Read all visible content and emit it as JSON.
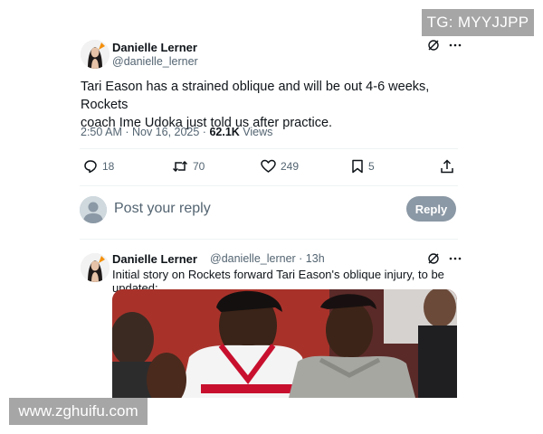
{
  "watermarks": {
    "tg": "TG: MYYJJPP",
    "site": "www.zghuifu.com"
  },
  "tweet": {
    "author_name": "Danielle Lerner",
    "author_handle": "@danielle_lerner",
    "text_line1": "Tari Eason has a strained oblique and will be out 4-6 weeks, Rockets",
    "text_line2": "coach Ime Udoka just told us after practice.",
    "timestamp": "2:50 AM · Nov 16, 2025 · ",
    "views_count": "62.1K",
    "views_label": " Views",
    "actions": {
      "replies": "18",
      "reposts": "70",
      "likes": "249",
      "bookmarks": "5"
    },
    "icons": [
      "grok-icon",
      "more-icon",
      "reply-icon",
      "repost-icon",
      "like-icon",
      "bookmark-icon",
      "share-icon"
    ]
  },
  "reply_box": {
    "placeholder": "Post your reply",
    "button_label": "Reply"
  },
  "reply_tweet": {
    "author_name": "Danielle Lerner",
    "handle_time": "@danielle_lerner · 13h",
    "text": "Initial story on Rockets forward Tari Eason's oblique injury, to be updated:"
  },
  "colors": {
    "text": "#0f1419",
    "secondary": "#536471",
    "reply_button": "#8b98a5",
    "flag": "#f4900c"
  }
}
